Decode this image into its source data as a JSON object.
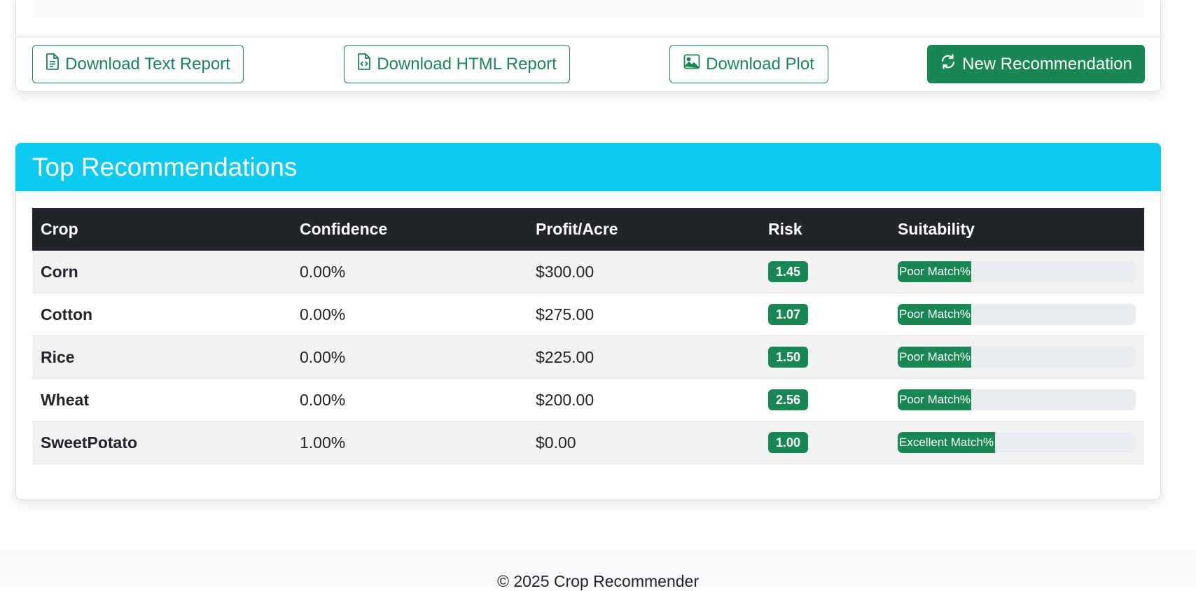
{
  "actions": {
    "download_text_label": "Download Text Report",
    "download_html_label": "Download HTML Report",
    "download_plot_label": "Download Plot",
    "new_recommendation_label": "New Recommendation"
  },
  "recommendations": {
    "title": "Top Recommendations",
    "columns": [
      "Crop",
      "Confidence",
      "Profit/Acre",
      "Risk",
      "Suitability"
    ],
    "rows": [
      {
        "crop": "Corn",
        "confidence": "0.00%",
        "profit": "$300.00",
        "risk": "1.45",
        "suitability": "Poor Match%",
        "suitability_fill": 0.31
      },
      {
        "crop": "Cotton",
        "confidence": "0.00%",
        "profit": "$275.00",
        "risk": "1.07",
        "suitability": "Poor Match%",
        "suitability_fill": 0.31
      },
      {
        "crop": "Rice",
        "confidence": "0.00%",
        "profit": "$225.00",
        "risk": "1.50",
        "suitability": "Poor Match%",
        "suitability_fill": 0.31
      },
      {
        "crop": "Wheat",
        "confidence": "0.00%",
        "profit": "$200.00",
        "risk": "2.56",
        "suitability": "Poor Match%",
        "suitability_fill": 0.31
      },
      {
        "crop": "SweetPotato",
        "confidence": "1.00%",
        "profit": "$0.00",
        "risk": "1.00",
        "suitability": "Excellent Match%",
        "suitability_fill": 0.41
      }
    ]
  },
  "footer": {
    "text": "© 2025 Crop Recommender"
  },
  "colors": {
    "primary_green": "#198754",
    "header_cyan": "#0dcaf0",
    "table_header": "#212529"
  }
}
